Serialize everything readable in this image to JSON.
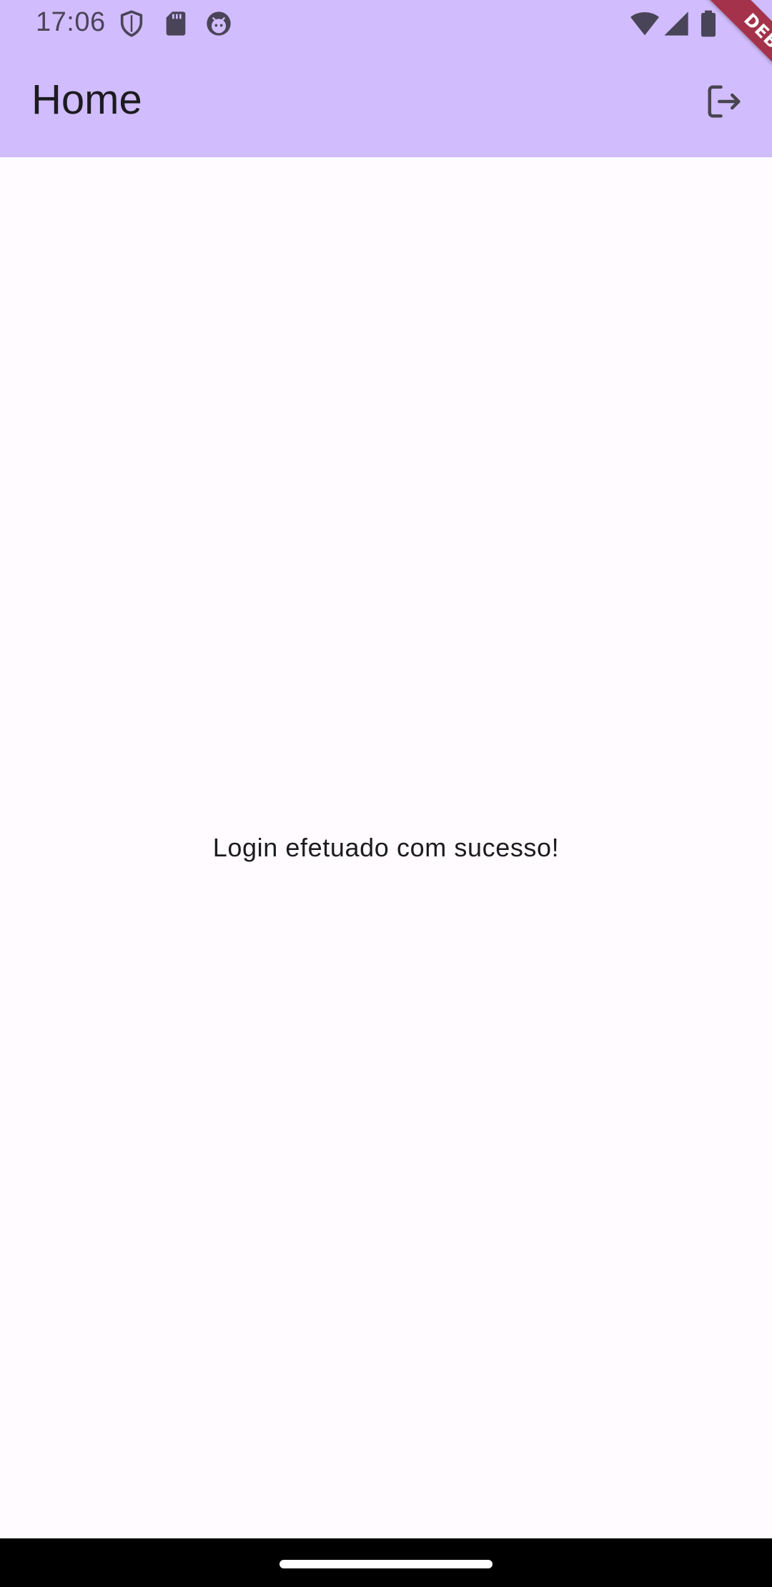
{
  "status_bar": {
    "time": "17:06",
    "icons_left": [
      "shield-icon",
      "sd-card-icon",
      "android-face-icon"
    ],
    "icons_right": [
      "wifi-icon",
      "cell-signal-icon",
      "battery-icon"
    ]
  },
  "app_bar": {
    "title": "Home",
    "action_icon": "logout-icon",
    "background_color": "#d1bcfd"
  },
  "debug_banner": {
    "label": "DEBUG",
    "color": "#a3324a"
  },
  "content": {
    "message": "Login efetuado com sucesso!"
  },
  "colors": {
    "page_background": "#fffbfe",
    "status_icon_color": "#4a4458",
    "text_color": "#1c1b1f"
  }
}
